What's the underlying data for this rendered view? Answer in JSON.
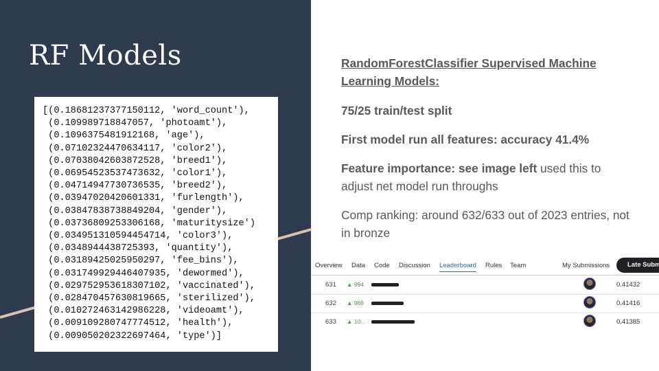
{
  "slide": {
    "title": "RF Models"
  },
  "feature_importances": [
    "[(0.18681237377150112, 'word_count'),",
    " (0.109989718847057, 'photoamt'),",
    " (0.1096375481912168, 'age'),",
    " (0.07102324470634117, 'color2'),",
    " (0.07038042603872528, 'breed1'),",
    " (0.06954523537473632, 'color1'),",
    " (0.04714947730736535, 'breed2'),",
    " (0.03947020420601331, 'furlength'),",
    " (0.03847838738849204, 'gender'),",
    " (0.03736809253306168, 'maturitysize')",
    " (0.03495131059445471​4, 'color3'),",
    " (0.0348944438725393, 'quantity'),",
    " (0.03189425025950297, 'fee_bins'),",
    " (0.031749929446407935, 'dewormed'),",
    " (0.029752953618307102, 'vaccinated'),",
    " (0.028470457630819665, 'sterilized'),",
    " (0.010272463142986228, 'videoamt'),",
    " (0.009109280747774512, 'health'),",
    " (0.009050202322697464, 'type')]"
  ],
  "notes": {
    "heading": "RandomForestClassifier Supervised Machine Learning Models:",
    "split": "75/25 train/test split",
    "first_model": "First model run all features: accuracy 41.4%",
    "feature_bold": "Feature importance: see image left",
    "feature_rest": " used this to adjust net model run throughs",
    "ranking": "Comp ranking: around 632/633 out of 2023 entries, not in bronze"
  },
  "leaderboard": {
    "tabs": [
      "Overview",
      "Data",
      "Code",
      "Discussion",
      "Leaderboard",
      "Rules",
      "Team"
    ],
    "active_tab": "Leaderboard",
    "my_submissions": "My Submissions",
    "late_submission": "Late Submi",
    "rows": [
      {
        "rank": "631",
        "change": "▲ 994",
        "score": "0.41432"
      },
      {
        "rank": "632",
        "change": "▲ 969",
        "score": "0.41416"
      },
      {
        "rank": "633",
        "change": "▲ 10...",
        "score": "0.41385"
      }
    ]
  },
  "colors": {
    "panel_bg": "#2f3a4f",
    "accent_line": "#d9c3b0",
    "text_gray": "#595959",
    "link_blue": "#2b6cb0",
    "rank_up_green": "#4c9b43"
  }
}
